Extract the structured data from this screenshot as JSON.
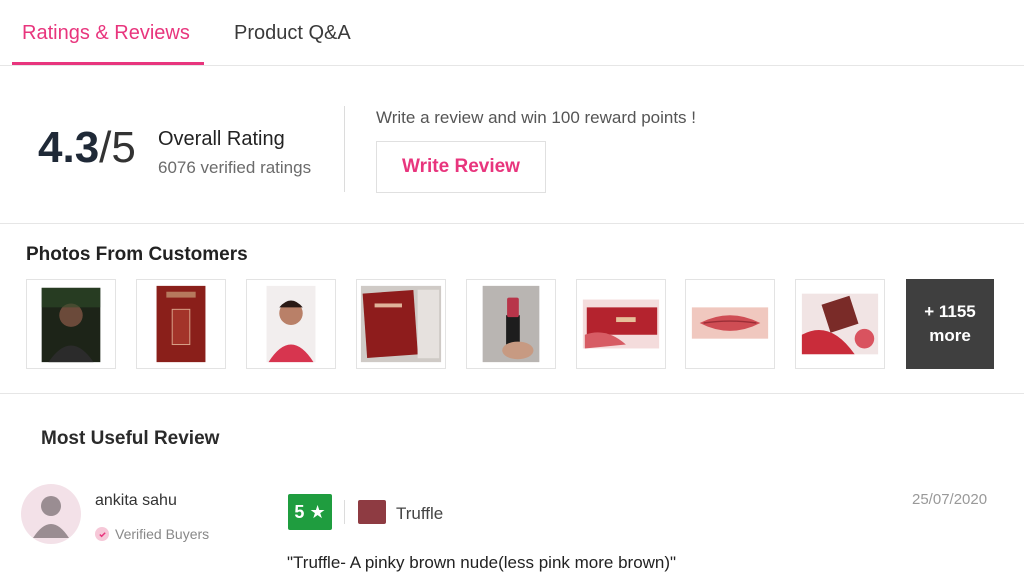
{
  "tabs": {
    "ratings_label": "Ratings & Reviews",
    "qa_label": "Product Q&A"
  },
  "rating": {
    "score": "4.3",
    "out_of": "/5",
    "label": "Overall Rating",
    "count_text": "6076 verified ratings",
    "promo": "Write a review and win 100 reward points !",
    "write_button": "Write Review"
  },
  "photos": {
    "title": "Photos From Customers",
    "more_count": "+ 1155",
    "more_label": "more"
  },
  "review_section": {
    "heading": "Most Useful Review",
    "reviewer": "ankita sahu",
    "verified": "Verified Buyers",
    "rating": "5",
    "star_icon": "★",
    "shade": "Truffle",
    "date": "25/07/2020",
    "title": "\"Truffle- A pinky brown nude(less pink more brown)\""
  },
  "colors": {
    "accent": "#e8357d",
    "rating_green": "#1f9d3f",
    "swatch": "#8e3b42"
  }
}
